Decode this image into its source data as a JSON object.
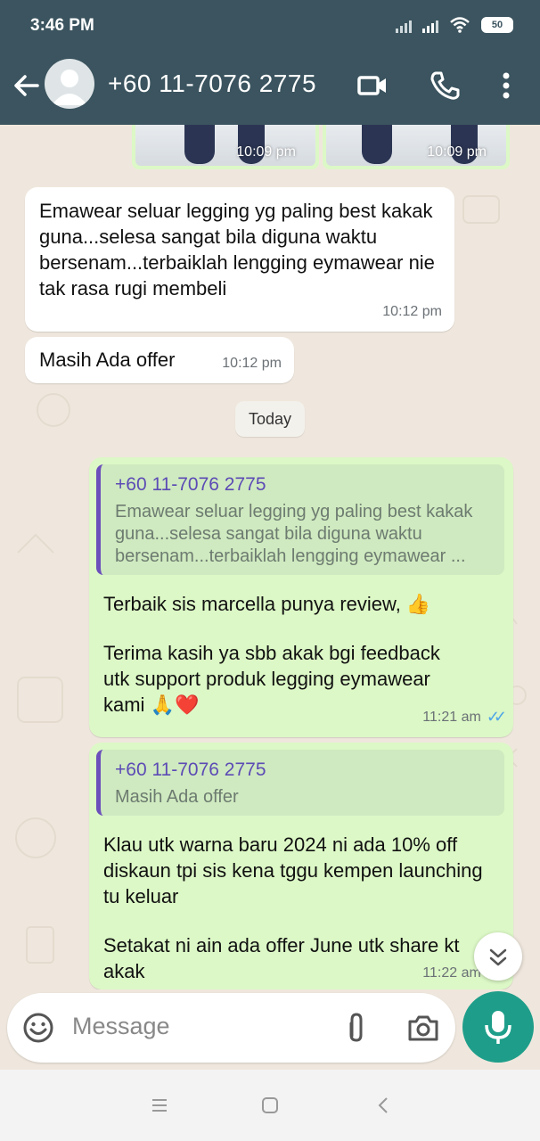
{
  "status_bar": {
    "time": "3:46 PM",
    "battery": "50"
  },
  "header": {
    "contact": "+60 11-7076 2775"
  },
  "earlier_images": [
    {
      "time": "10:09 pm"
    },
    {
      "time": "10:09 pm"
    }
  ],
  "messages": [
    {
      "direction": "in",
      "text": "Emawear seluar legging yg paling best kakak guna...selesa sangat bila diguna waktu bersenam...terbaiklah lengging eymawear nie tak rasa rugi membeli",
      "time": "10:12 pm"
    },
    {
      "direction": "in",
      "text": "Masih Ada offer",
      "time": "10:12 pm"
    }
  ],
  "day_separator": "Today",
  "replies": [
    {
      "quote_name": "+60 11-7076 2775",
      "quote_text": "Emawear seluar legging yg paling best kakak guna...selesa sangat bila diguna waktu bersenam...terbaiklah lengging eymawear ...",
      "para1": "Terbaik sis marcella punya review, 👍",
      "para2": "Terima kasih ya sbb akak bgi feedback utk support produk legging eymawear kami 🙏❤️",
      "time": "11:21 am"
    },
    {
      "quote_name": "+60 11-7076 2775",
      "quote_text": "Masih Ada offer",
      "para1": "Klau utk warna baru 2024 ni ada 10% off diskaun tpi sis kena tggu kempen launching tu keluar",
      "para2": "Setakat ni ain ada offer June utk share kt akak",
      "time": "11:22 am"
    }
  ],
  "composer": {
    "placeholder": "Message"
  },
  "colors": {
    "header": "#3b545f",
    "outgoing": "#dcf8c6",
    "incoming": "#ffffff",
    "mic": "#1e9e8a",
    "quote_bar": "#6b4fbb"
  }
}
